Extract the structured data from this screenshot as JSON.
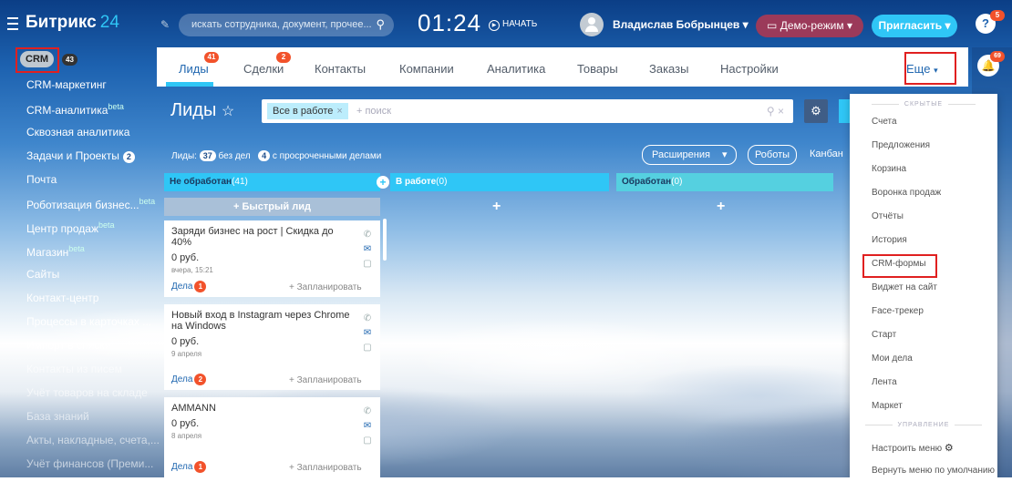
{
  "header": {
    "logo_main": "Битрикс",
    "logo_num": "24",
    "search_placeholder": "искать сотрудника, документ, прочее...",
    "clock": "01:24",
    "start_label": "НАЧАТЬ",
    "user_name": "Владислав Бобрынцев",
    "demo_label": "Демо-режим",
    "invite_label": "Пригласить",
    "help_count": "5",
    "notif_count": "69"
  },
  "sidebar": {
    "crm_label": "CRM",
    "crm_count": "43",
    "items": [
      {
        "label": "CRM-маркетинг"
      },
      {
        "label": "CRM-аналитика",
        "sup": "beta"
      },
      {
        "label": "Сквозная аналитика"
      },
      {
        "label": "Задачи и Проекты",
        "count": "2"
      },
      {
        "label": "Почта"
      },
      {
        "label": "Роботизация бизнес...",
        "sup": "beta"
      },
      {
        "label": "Центр продаж",
        "sup": "beta"
      },
      {
        "label": "Магазин",
        "sup": "beta"
      },
      {
        "label": "Сайты"
      },
      {
        "label": "Контакт-центр"
      },
      {
        "label": "Процессы в карточках ..."
      },
      {
        "label": "Импорт в списки"
      },
      {
        "label": "Контакты из писем"
      },
      {
        "label": "Учёт товаров на складе"
      },
      {
        "label": "База знаний"
      },
      {
        "label": "Акты, накладные, счета,..."
      },
      {
        "label": "Учёт финансов (Преми..."
      }
    ]
  },
  "tabs": [
    {
      "label": "Лиды",
      "badge": "41"
    },
    {
      "label": "Сделки",
      "badge": "2"
    },
    {
      "label": "Контакты"
    },
    {
      "label": "Компании"
    },
    {
      "label": "Аналитика"
    },
    {
      "label": "Товары"
    },
    {
      "label": "Заказы"
    },
    {
      "label": "Настройки"
    }
  ],
  "more_label": "Еще",
  "leads": {
    "title": "Лиды",
    "filter_tag": "Все в работе",
    "filter_placeholder": "+ поиск",
    "stats_prefix": "Лиды:",
    "stats_count": "37",
    "stats_nodeals": "без дел",
    "stats_overdue_count": "4",
    "stats_overdue": "с просроченными делами",
    "extensions_label": "Расширения",
    "robots_label": "Роботы",
    "kanban_label": "Канбан"
  },
  "columns": [
    {
      "title": "Не обработан",
      "count": "(41)",
      "color": "#2fc6f6"
    },
    {
      "title": "В работе",
      "count": "(0)",
      "color": "#2fc6f6"
    },
    {
      "title": "Обработан",
      "count": "(0)",
      "color": "#55d0e0"
    }
  ],
  "quick_lead": "+ Быстрый лид",
  "cards": [
    {
      "title": "Заряди бизнес на рост | Скидка до 40%",
      "sum": "0 руб.",
      "date": "вчера, 15:21",
      "deals": "Дела",
      "deals_count": "1",
      "plan": "+ Запланировать"
    },
    {
      "title": "Новый вход в Instagram через Chrome на Windows",
      "sum": "0 руб.",
      "date": "9 апреля",
      "deals": "Дела",
      "deals_count": "2",
      "plan": "+ Запланировать"
    },
    {
      "title": "AMMANN",
      "sum": "0 руб.",
      "date": "8 апреля",
      "deals": "Дела",
      "deals_count": "1",
      "plan": "+ Запланировать"
    }
  ],
  "dropdown": {
    "section_hidden": "СКРЫТЫЕ",
    "items": [
      "Счета",
      "Предложения",
      "Корзина",
      "Воронка продаж",
      "Отчёты",
      "История",
      "CRM-формы",
      "Виджет на сайт",
      "Face-трекер",
      "Старт",
      "Мои дела",
      "Лента",
      "Маркет"
    ],
    "section_manage": "УПРАВЛЕНИЕ",
    "manage_items": [
      "Настроить меню",
      "Вернуть меню по умолчанию"
    ]
  }
}
